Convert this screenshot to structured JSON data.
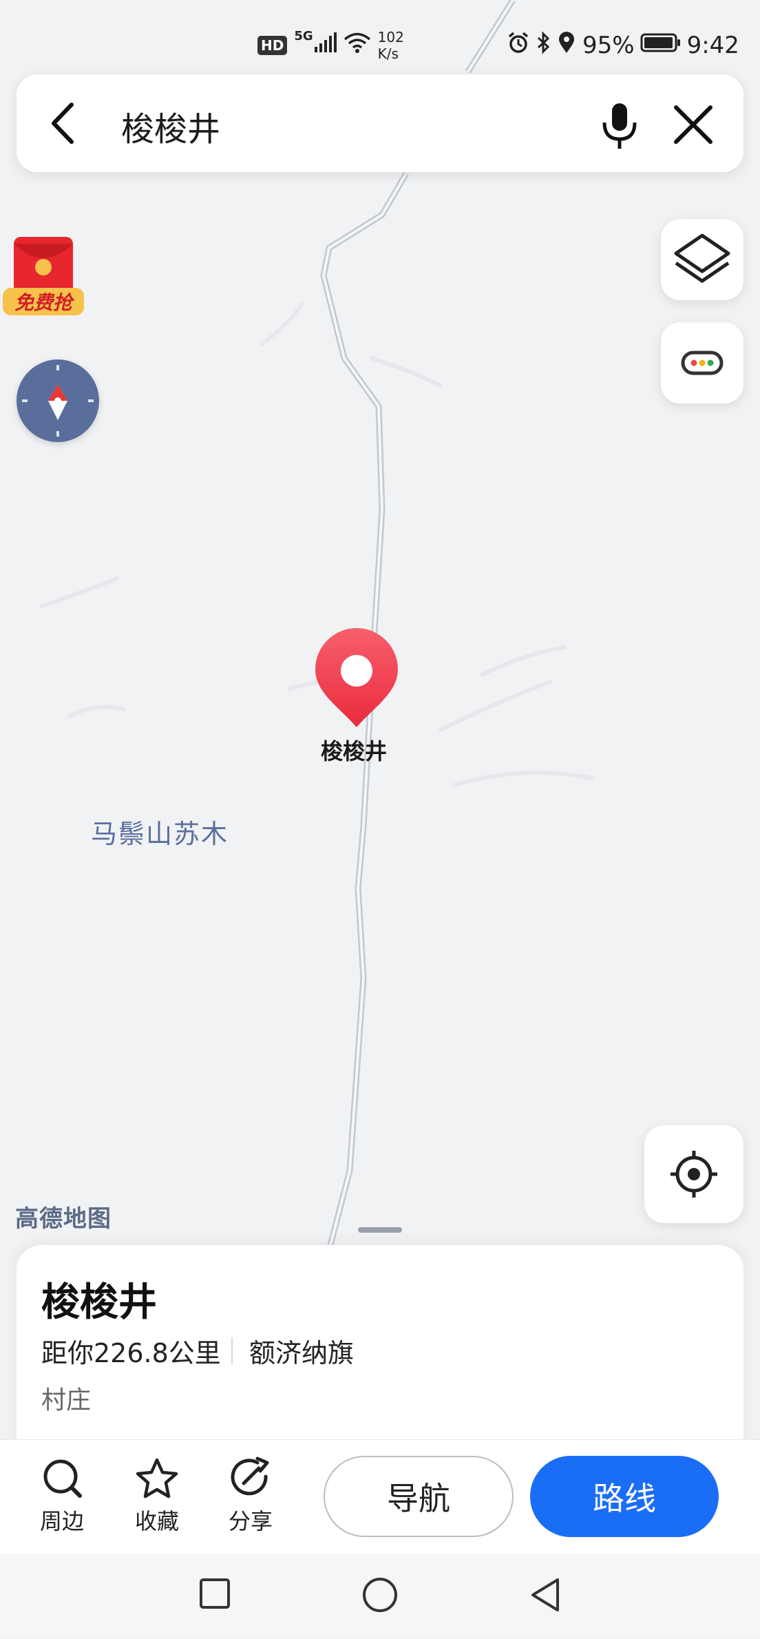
{
  "status_bar": {
    "hd": "HD",
    "network": "5G",
    "speed_value": "102",
    "speed_unit": "K/s",
    "battery": "95%",
    "time": "9:42"
  },
  "search": {
    "query": "梭梭井",
    "icons": [
      "back-arrow-icon",
      "microphone-icon",
      "close-icon"
    ]
  },
  "promo": {
    "label": "免费抢"
  },
  "map": {
    "place_label": "马鬃山苏木",
    "pin_label": "梭梭井",
    "brand": "高德地图"
  },
  "place_card": {
    "name": "梭梭井",
    "distance": "距你226.8公里",
    "region": "额济纳旗",
    "category": "村庄"
  },
  "actions": {
    "nearby": "周边",
    "favorite": "收藏",
    "share": "分享",
    "navigate": "导航",
    "route": "路线"
  },
  "colors": {
    "accent": "#1a6ef5",
    "pin": "#f04455",
    "compass": "#5a6e9c"
  }
}
